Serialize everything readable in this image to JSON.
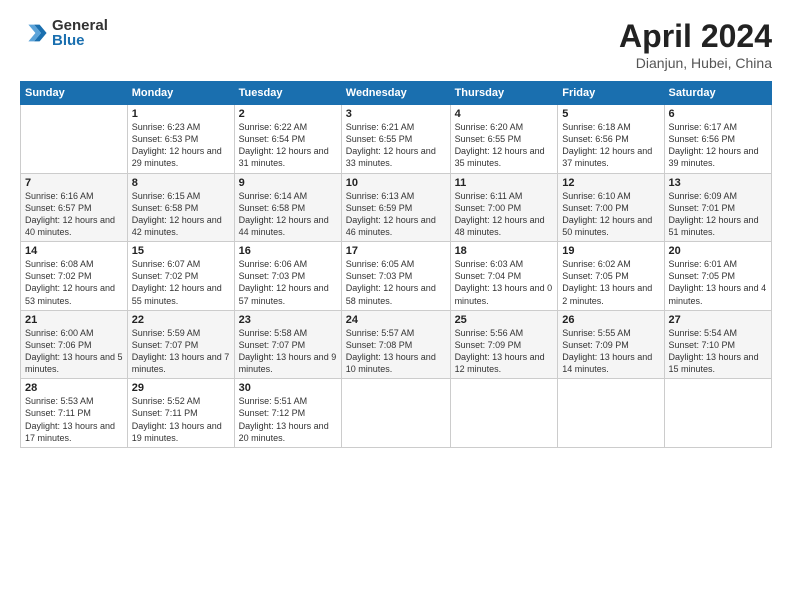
{
  "logo": {
    "general": "General",
    "blue": "Blue"
  },
  "title": {
    "month": "April 2024",
    "location": "Dianjun, Hubei, China"
  },
  "weekdays": [
    "Sunday",
    "Monday",
    "Tuesday",
    "Wednesday",
    "Thursday",
    "Friday",
    "Saturday"
  ],
  "weeks": [
    [
      {
        "day": "",
        "info": ""
      },
      {
        "day": "1",
        "info": "Sunrise: 6:23 AM\nSunset: 6:53 PM\nDaylight: 12 hours\nand 29 minutes."
      },
      {
        "day": "2",
        "info": "Sunrise: 6:22 AM\nSunset: 6:54 PM\nDaylight: 12 hours\nand 31 minutes."
      },
      {
        "day": "3",
        "info": "Sunrise: 6:21 AM\nSunset: 6:55 PM\nDaylight: 12 hours\nand 33 minutes."
      },
      {
        "day": "4",
        "info": "Sunrise: 6:20 AM\nSunset: 6:55 PM\nDaylight: 12 hours\nand 35 minutes."
      },
      {
        "day": "5",
        "info": "Sunrise: 6:18 AM\nSunset: 6:56 PM\nDaylight: 12 hours\nand 37 minutes."
      },
      {
        "day": "6",
        "info": "Sunrise: 6:17 AM\nSunset: 6:56 PM\nDaylight: 12 hours\nand 39 minutes."
      }
    ],
    [
      {
        "day": "7",
        "info": "Sunrise: 6:16 AM\nSunset: 6:57 PM\nDaylight: 12 hours\nand 40 minutes."
      },
      {
        "day": "8",
        "info": "Sunrise: 6:15 AM\nSunset: 6:58 PM\nDaylight: 12 hours\nand 42 minutes."
      },
      {
        "day": "9",
        "info": "Sunrise: 6:14 AM\nSunset: 6:58 PM\nDaylight: 12 hours\nand 44 minutes."
      },
      {
        "day": "10",
        "info": "Sunrise: 6:13 AM\nSunset: 6:59 PM\nDaylight: 12 hours\nand 46 minutes."
      },
      {
        "day": "11",
        "info": "Sunrise: 6:11 AM\nSunset: 7:00 PM\nDaylight: 12 hours\nand 48 minutes."
      },
      {
        "day": "12",
        "info": "Sunrise: 6:10 AM\nSunset: 7:00 PM\nDaylight: 12 hours\nand 50 minutes."
      },
      {
        "day": "13",
        "info": "Sunrise: 6:09 AM\nSunset: 7:01 PM\nDaylight: 12 hours\nand 51 minutes."
      }
    ],
    [
      {
        "day": "14",
        "info": "Sunrise: 6:08 AM\nSunset: 7:02 PM\nDaylight: 12 hours\nand 53 minutes."
      },
      {
        "day": "15",
        "info": "Sunrise: 6:07 AM\nSunset: 7:02 PM\nDaylight: 12 hours\nand 55 minutes."
      },
      {
        "day": "16",
        "info": "Sunrise: 6:06 AM\nSunset: 7:03 PM\nDaylight: 12 hours\nand 57 minutes."
      },
      {
        "day": "17",
        "info": "Sunrise: 6:05 AM\nSunset: 7:03 PM\nDaylight: 12 hours\nand 58 minutes."
      },
      {
        "day": "18",
        "info": "Sunrise: 6:03 AM\nSunset: 7:04 PM\nDaylight: 13 hours\nand 0 minutes."
      },
      {
        "day": "19",
        "info": "Sunrise: 6:02 AM\nSunset: 7:05 PM\nDaylight: 13 hours\nand 2 minutes."
      },
      {
        "day": "20",
        "info": "Sunrise: 6:01 AM\nSunset: 7:05 PM\nDaylight: 13 hours\nand 4 minutes."
      }
    ],
    [
      {
        "day": "21",
        "info": "Sunrise: 6:00 AM\nSunset: 7:06 PM\nDaylight: 13 hours\nand 5 minutes."
      },
      {
        "day": "22",
        "info": "Sunrise: 5:59 AM\nSunset: 7:07 PM\nDaylight: 13 hours\nand 7 minutes."
      },
      {
        "day": "23",
        "info": "Sunrise: 5:58 AM\nSunset: 7:07 PM\nDaylight: 13 hours\nand 9 minutes."
      },
      {
        "day": "24",
        "info": "Sunrise: 5:57 AM\nSunset: 7:08 PM\nDaylight: 13 hours\nand 10 minutes."
      },
      {
        "day": "25",
        "info": "Sunrise: 5:56 AM\nSunset: 7:09 PM\nDaylight: 13 hours\nand 12 minutes."
      },
      {
        "day": "26",
        "info": "Sunrise: 5:55 AM\nSunset: 7:09 PM\nDaylight: 13 hours\nand 14 minutes."
      },
      {
        "day": "27",
        "info": "Sunrise: 5:54 AM\nSunset: 7:10 PM\nDaylight: 13 hours\nand 15 minutes."
      }
    ],
    [
      {
        "day": "28",
        "info": "Sunrise: 5:53 AM\nSunset: 7:11 PM\nDaylight: 13 hours\nand 17 minutes."
      },
      {
        "day": "29",
        "info": "Sunrise: 5:52 AM\nSunset: 7:11 PM\nDaylight: 13 hours\nand 19 minutes."
      },
      {
        "day": "30",
        "info": "Sunrise: 5:51 AM\nSunset: 7:12 PM\nDaylight: 13 hours\nand 20 minutes."
      },
      {
        "day": "",
        "info": ""
      },
      {
        "day": "",
        "info": ""
      },
      {
        "day": "",
        "info": ""
      },
      {
        "day": "",
        "info": ""
      }
    ]
  ]
}
